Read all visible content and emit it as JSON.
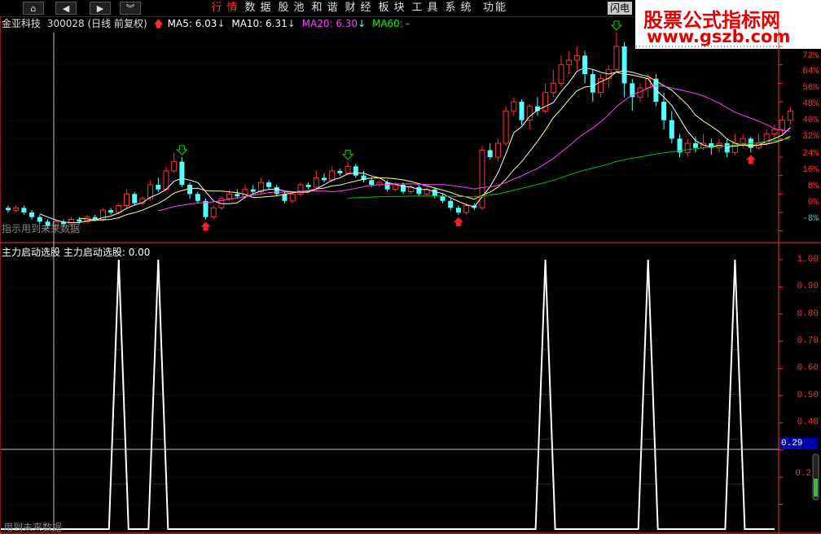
{
  "nav": {
    "home_icon": "home-icon",
    "back_icon": "left-arrow-icon",
    "forward_icon": "right-arrow-icon",
    "more_icon": "double-chevron-down-icon"
  },
  "menu": [
    "行情",
    "数据",
    "股池",
    "和谐",
    "财经",
    "板块",
    "工具",
    "系统",
    "功能"
  ],
  "flash_label": "闪电",
  "watermark": {
    "line1": "股票公式指标网",
    "line2": "www.gszb.com"
  },
  "stock": {
    "name": "金亚科技",
    "code": "300028",
    "period": "(日线 前复权)"
  },
  "ma": [
    {
      "label": "MA5: 6.03",
      "color": "#ffffff",
      "arrow": "down"
    },
    {
      "label": "MA10: 6.31",
      "color": "#ffffff",
      "arrow": "down"
    },
    {
      "label": "MA20: 6.30",
      "color": "#ff40ff",
      "arrow": "down"
    },
    {
      "label": "MA60: -",
      "color": "#00ff00",
      "arrow": "none"
    }
  ],
  "main_axis_ticks": [
    "72%",
    "64%",
    "56%",
    "48%",
    "40%",
    "32%",
    "24%",
    "16%",
    "8%",
    "0%",
    "-8%"
  ],
  "main_hint": "指示用到未来数据",
  "sub_panel": {
    "title": "主力启动选股",
    "value_label": "主力启动选股: 0.00"
  },
  "sub_axis_ticks": [
    "1.00",
    "0.90",
    "0.80",
    "0.70",
    "0.60",
    "0.50",
    "0.40",
    "0.30",
    "0.2"
  ],
  "sub_hint": "用到未来数据",
  "cursor_value": "0.29",
  "colors": {
    "up": "#ff3232",
    "down": "#54ffff",
    "ma5": "#ffffff",
    "ma10": "#ffff80",
    "ma20": "#ff40ff",
    "ma60": "#00c000",
    "grid": "#800000",
    "axis": "#ff3232"
  },
  "chart_data": [
    {
      "type": "candlestick",
      "title": "金亚科技 300028 (日线 前复权)",
      "ylabel": "% change",
      "ylim": [
        -12,
        78
      ],
      "candles": [
        [
          2,
          1,
          3,
          0
        ],
        [
          1,
          2,
          3,
          0
        ],
        [
          2,
          0,
          3,
          -1
        ],
        [
          0,
          -2,
          1,
          -3
        ],
        [
          -2,
          -4,
          -1,
          -5
        ],
        [
          -4,
          -6,
          -3,
          -7
        ],
        [
          -6,
          -4,
          -3,
          -7
        ],
        [
          -4,
          -5,
          -3,
          -6
        ],
        [
          -5,
          -3,
          -2,
          -6
        ],
        [
          -3,
          -4,
          -2,
          -5
        ],
        [
          -4,
          -2,
          -1,
          -5
        ],
        [
          -2,
          -3,
          -1,
          -4
        ],
        [
          -3,
          1,
          2,
          -4
        ],
        [
          1,
          0,
          2,
          -1
        ],
        [
          0,
          3,
          4,
          -1
        ],
        [
          3,
          8,
          10,
          2
        ],
        [
          8,
          4,
          9,
          3
        ],
        [
          4,
          6,
          7,
          3
        ],
        [
          6,
          12,
          14,
          5
        ],
        [
          12,
          10,
          15,
          9
        ],
        [
          10,
          18,
          20,
          9
        ],
        [
          18,
          22,
          26,
          17
        ],
        [
          22,
          12,
          24,
          11
        ],
        [
          12,
          8,
          13,
          6
        ],
        [
          8,
          5,
          9,
          4
        ],
        [
          5,
          -2,
          6,
          -3
        ],
        [
          -2,
          2,
          3,
          -3
        ],
        [
          2,
          6,
          7,
          1
        ],
        [
          6,
          8,
          10,
          5
        ],
        [
          8,
          7,
          10,
          6
        ],
        [
          7,
          10,
          12,
          6
        ],
        [
          10,
          9,
          12,
          8
        ],
        [
          9,
          13,
          15,
          8
        ],
        [
          13,
          11,
          14,
          10
        ],
        [
          11,
          8,
          12,
          7
        ],
        [
          8,
          5,
          9,
          4
        ],
        [
          5,
          8,
          9,
          4
        ],
        [
          8,
          12,
          13,
          7
        ],
        [
          12,
          11,
          13,
          10
        ],
        [
          11,
          15,
          18,
          10
        ],
        [
          15,
          14,
          17,
          13
        ],
        [
          14,
          18,
          20,
          13
        ],
        [
          18,
          17,
          19,
          16
        ],
        [
          17,
          20,
          22,
          16
        ],
        [
          20,
          16,
          21,
          15
        ],
        [
          16,
          14,
          18,
          13
        ],
        [
          14,
          12,
          15,
          11
        ],
        [
          12,
          13,
          14,
          11
        ],
        [
          13,
          10,
          14,
          9
        ],
        [
          10,
          12,
          13,
          9
        ],
        [
          12,
          9,
          13,
          8
        ],
        [
          9,
          11,
          12,
          8
        ],
        [
          11,
          8,
          12,
          7
        ],
        [
          8,
          10,
          11,
          7
        ],
        [
          10,
          7,
          11,
          6
        ],
        [
          7,
          5,
          8,
          4
        ],
        [
          5,
          2,
          6,
          1
        ],
        [
          2,
          0,
          3,
          -1
        ],
        [
          0,
          3,
          4,
          -1
        ],
        [
          3,
          2,
          4,
          1
        ],
        [
          2,
          27,
          29,
          1
        ],
        [
          27,
          24,
          30,
          23
        ],
        [
          24,
          30,
          32,
          22
        ],
        [
          30,
          44,
          46,
          29
        ],
        [
          44,
          48,
          50,
          42
        ],
        [
          48,
          40,
          49,
          38
        ],
        [
          40,
          46,
          47,
          36
        ],
        [
          46,
          44,
          50,
          42
        ],
        [
          44,
          52,
          56,
          43
        ],
        [
          52,
          56,
          62,
          50
        ],
        [
          56,
          64,
          68,
          55
        ],
        [
          64,
          66,
          70,
          60
        ],
        [
          66,
          68,
          72,
          62
        ],
        [
          68,
          60,
          70,
          56
        ],
        [
          60,
          52,
          62,
          48
        ],
        [
          52,
          58,
          60,
          50
        ],
        [
          58,
          62,
          64,
          54
        ],
        [
          62,
          72,
          78,
          61
        ],
        [
          72,
          56,
          74,
          50
        ],
        [
          56,
          50,
          58,
          44
        ],
        [
          50,
          54,
          56,
          48
        ],
        [
          54,
          58,
          60,
          50
        ],
        [
          58,
          48,
          60,
          46
        ],
        [
          48,
          40,
          52,
          36
        ],
        [
          40,
          32,
          44,
          30
        ],
        [
          32,
          26,
          34,
          24
        ],
        [
          26,
          30,
          32,
          24
        ],
        [
          30,
          28,
          33,
          26
        ],
        [
          28,
          30,
          34,
          27
        ],
        [
          30,
          28,
          32,
          25
        ],
        [
          28,
          30,
          32,
          26
        ],
        [
          30,
          26,
          32,
          24
        ],
        [
          26,
          30,
          34,
          25
        ],
        [
          30,
          32,
          34,
          28
        ],
        [
          32,
          28,
          33,
          26
        ],
        [
          28,
          30,
          34,
          27
        ],
        [
          30,
          34,
          36,
          29
        ],
        [
          34,
          36,
          38,
          32
        ],
        [
          36,
          40,
          42,
          34
        ],
        [
          40,
          44,
          46,
          38
        ]
      ],
      "arrows": [
        {
          "index": 22,
          "direction": "down",
          "color": "green"
        },
        {
          "index": 25,
          "direction": "up",
          "color": "red"
        },
        {
          "index": 43,
          "direction": "down",
          "color": "green"
        },
        {
          "index": 57,
          "direction": "up",
          "color": "red"
        },
        {
          "index": 77,
          "direction": "down",
          "color": "green"
        },
        {
          "index": 94,
          "direction": "up",
          "color": "red"
        }
      ]
    },
    {
      "type": "line",
      "title": "主力启动选股",
      "ylim": [
        0,
        1
      ],
      "spike_indices": [
        14,
        19,
        68,
        81,
        92
      ],
      "values_note_removed": true
    }
  ]
}
